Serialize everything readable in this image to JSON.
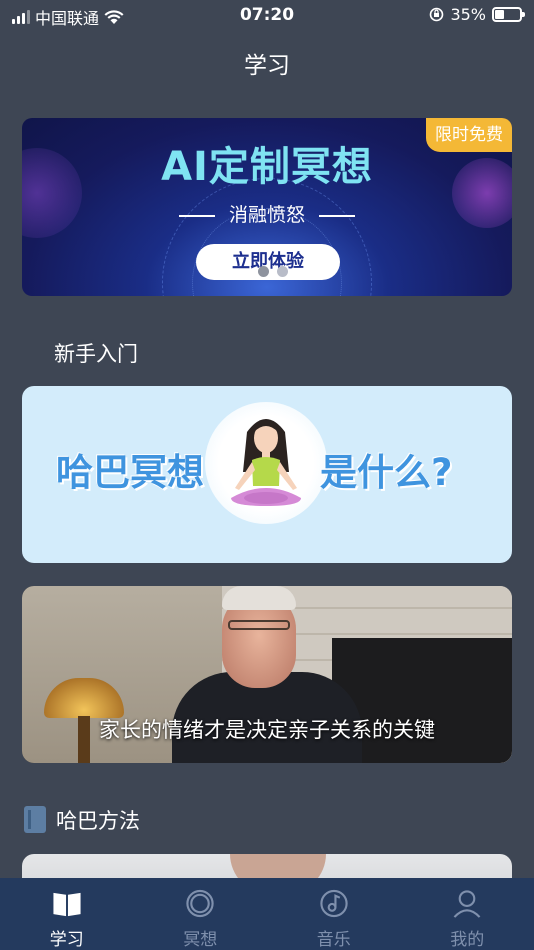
{
  "status_bar": {
    "carrier": "中国联通",
    "time": "07:20",
    "battery_percent": "35%",
    "battery_level": 0.35
  },
  "header": {
    "title": "学习"
  },
  "banner": {
    "title": "AI定制冥想",
    "subtitle": "消融愤怒",
    "cta_label": "立即体验",
    "badge": "限时免费",
    "page_count": 2,
    "active_index": 0
  },
  "sections": {
    "beginner_title": "新手入门",
    "method_title": "哈巴方法"
  },
  "intro_card": {
    "left_text": "哈巴冥想",
    "right_text": "是什么?"
  },
  "video_card": {
    "caption": "家长的情绪才是决定亲子关系的关键"
  },
  "tab_bar": {
    "tabs": [
      {
        "label": "学习",
        "icon": "book-icon",
        "active": true
      },
      {
        "label": "冥想",
        "icon": "circle-icon",
        "active": false
      },
      {
        "label": "音乐",
        "icon": "music-disc-icon",
        "active": false
      },
      {
        "label": "我的",
        "icon": "user-icon",
        "active": false
      }
    ]
  },
  "colors": {
    "background": "#3e4654",
    "tab_bar": "#243a5e",
    "badge": "#f4b836",
    "intro_card": "#d3ecfb",
    "intro_text": "#3f94df"
  }
}
